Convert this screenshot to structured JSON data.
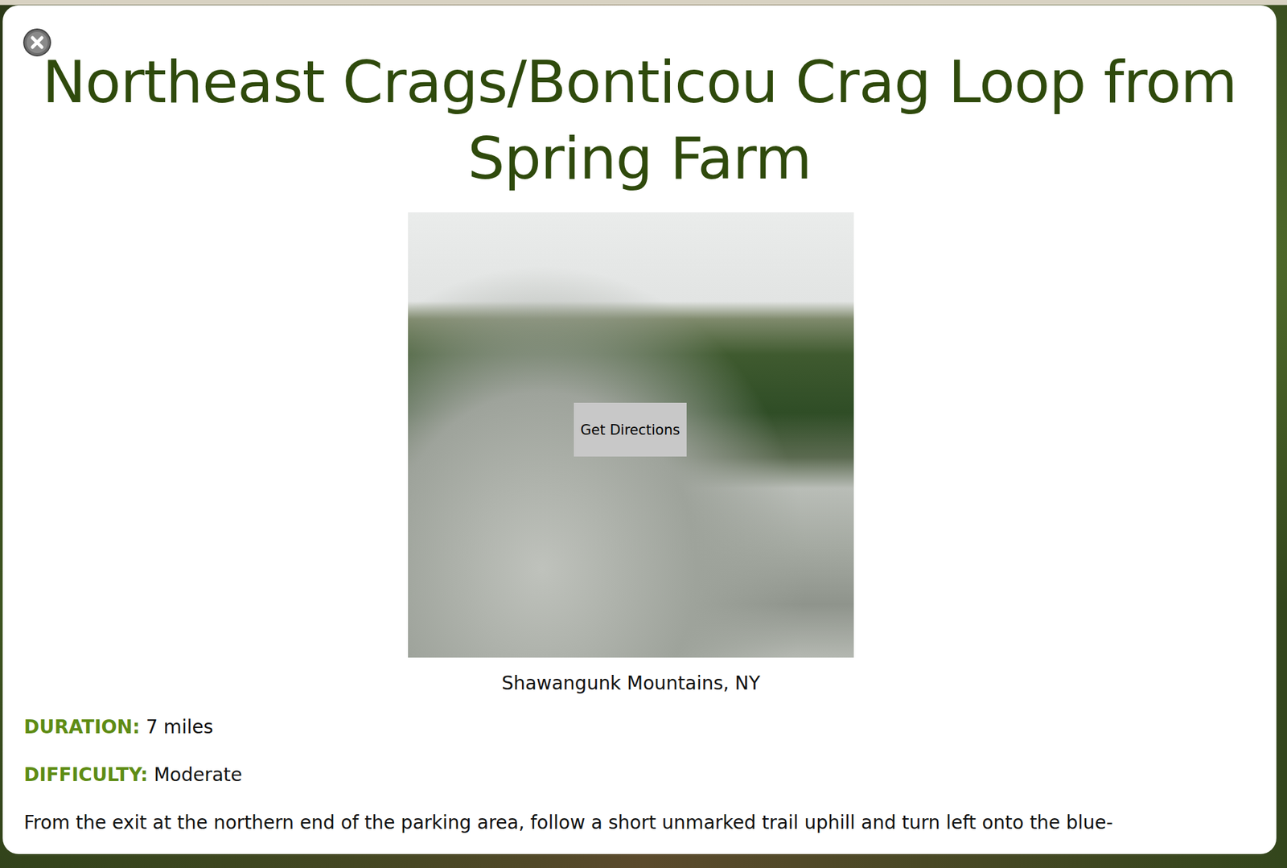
{
  "dialog": {
    "title": "Northeast Crags/Bonticou Crag Loop from Spring Farm",
    "photo": {
      "button": "Get Directions",
      "caption": "Shawangunk Mountains, NY"
    },
    "details": [
      {
        "label": "DURATION:",
        "value": "7 miles"
      },
      {
        "label": "DIFFICULTY:",
        "value": "Moderate"
      }
    ],
    "description": "From the exit at the northern end of the parking area, follow a short unmarked trail uphill and turn left onto the blue-"
  }
}
